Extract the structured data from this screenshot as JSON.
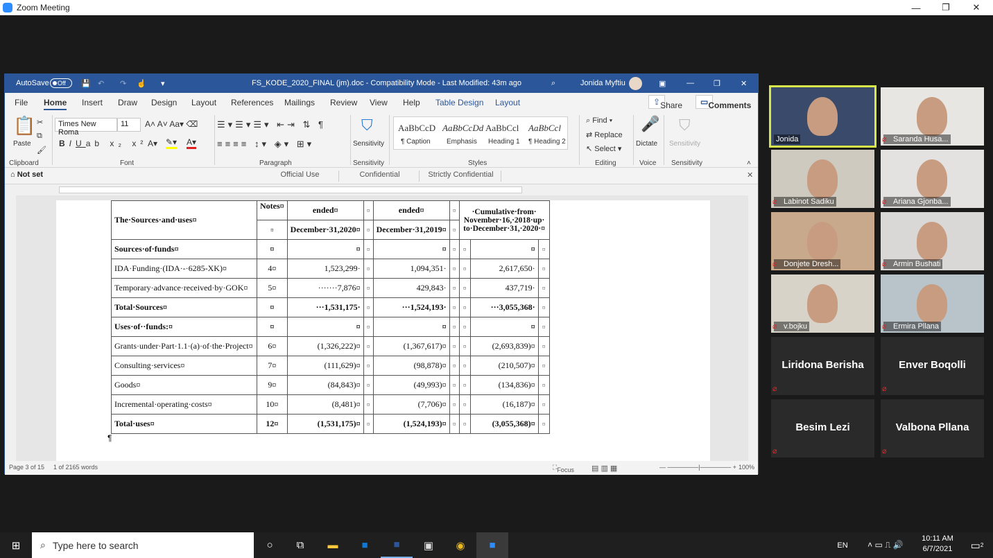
{
  "zoom": {
    "title": "Zoom Meeting"
  },
  "word": {
    "autosave_label": "AutoSave",
    "autosave_state": "Off",
    "doc_title": "FS_KODE_2020_FINAL (jm).doc  -  Compatibility Mode  -  Last Modified: 43m ago",
    "user": "Jonida Myftiu",
    "tabs": [
      "File",
      "Home",
      "Insert",
      "Draw",
      "Design",
      "Layout",
      "References",
      "Mailings",
      "Review",
      "View",
      "Help",
      "Table Design",
      "Layout"
    ],
    "share": "Share",
    "comments": "Comments",
    "ribbon": {
      "paste": "Paste",
      "font_name": "Times New Roma",
      "font_size": "11",
      "groups": [
        "Clipboard",
        "Font",
        "Paragraph",
        "Sensitivity",
        "Styles",
        "Editing",
        "Voice",
        "Sensitivity"
      ],
      "styles": [
        {
          "sample": "AaBbCcD",
          "name": "¶ Caption"
        },
        {
          "sample": "AaBbCcDd",
          "name": "Emphasis"
        },
        {
          "sample": "AaBbCcl",
          "name": "Heading 1"
        },
        {
          "sample": "AaBbCcl",
          "name": "¶ Heading 2"
        }
      ],
      "sensitivity": "Sensitivity",
      "find": "Find",
      "replace": "Replace",
      "select": "Select",
      "dictate": "Dictate",
      "sensitivity2": "Sensitivity"
    },
    "sensbar": {
      "not_set": "Not set",
      "labels": [
        "Official Use",
        "Confidential",
        "Strictly Confidential"
      ]
    },
    "table": {
      "header_title": "The·Sources·and·uses¤",
      "notes": "Notes¤",
      "ended1": "ended¤",
      "ended2": "ended¤",
      "date1": "December·31,2020¤",
      "date2": "December·31,2019¤",
      "cumulative": "·Cumulative·from· November·16,·2018·up· to·December·31,·2020·¤",
      "rows": [
        {
          "label": "Sources·of·funds¤",
          "note": "¤",
          "a": "¤",
          "b": "¤",
          "c": "¤",
          "bold": true
        },
        {
          "label": "IDA·Funding·(IDA·-·6285-XK)¤",
          "note": "4¤",
          "a": "1,523,299·",
          "b": "1,094,351·",
          "c": "2,617,650·",
          "bold": false
        },
        {
          "label": "Temporary·advance·received·by·GOK¤",
          "note": "5¤",
          "a": "·······7,876¤",
          "b": "429,843·",
          "c": "437,719·",
          "bold": false
        },
        {
          "label": "Total·Sources¤",
          "note": "¤",
          "a": "···1,531,175·",
          "b": "···1,524,193·",
          "c": "···3,055,368·",
          "bold": true
        },
        {
          "label": "Uses·of··funds:¤",
          "note": "¤",
          "a": "¤",
          "b": "¤",
          "c": "¤",
          "bold": true
        },
        {
          "label": "Grants·under·Part·1.1·(a)·of·the·Project¤",
          "note": "6¤",
          "a": "(1,326,222)¤",
          "b": "(1,367,617)¤",
          "c": "(2,693,839)¤",
          "bold": false
        },
        {
          "label": "Consulting·services¤",
          "note": "7¤",
          "a": "(111,629)¤",
          "b": "(98,878)¤",
          "c": "(210,507)¤",
          "bold": false
        },
        {
          "label": "Goods¤",
          "note": "9¤",
          "a": "(84,843)¤",
          "b": "(49,993)¤",
          "c": "(134,836)¤",
          "bold": false
        },
        {
          "label": "Incremental·operating·costs¤",
          "note": "10¤",
          "a": "(8,481)¤",
          "b": "(7,706)¤",
          "c": "(16,187)¤",
          "bold": false
        },
        {
          "label": "Total·uses¤",
          "note": "12¤",
          "a": "(1,531,175)¤",
          "b": "(1,524,193)¤",
          "c": "(3,055,368)¤",
          "bold": true
        }
      ],
      "para": "¶"
    },
    "status": {
      "page": "Page 3 of 15",
      "words": "1 of 2165 words",
      "focus": "Focus",
      "zoom": "100%"
    }
  },
  "participants": [
    {
      "name": "Jonida",
      "muted": false,
      "video": true,
      "active": true,
      "bg": "#3a4a6a"
    },
    {
      "name": "Saranda Husa...",
      "muted": true,
      "video": true,
      "bg": "#e8e6e2"
    },
    {
      "name": "Labinot Sadiku",
      "muted": true,
      "video": true,
      "bg": "#cfcac0"
    },
    {
      "name": "Ariana Gjonba...",
      "muted": true,
      "video": true,
      "bg": "#e4e2e0"
    },
    {
      "name": "Donjete Dresh...",
      "muted": true,
      "video": true,
      "bg": "#c9a98c"
    },
    {
      "name": "Armin Bushati",
      "muted": true,
      "video": true,
      "bg": "#d9d8d6"
    },
    {
      "name": "v.bojku",
      "muted": true,
      "video": true,
      "bg": "#d8d3c8"
    },
    {
      "name": "Ermira  Pllana",
      "muted": true,
      "video": true,
      "bg": "#b9c4ca"
    },
    {
      "name": "Liridona Berisha",
      "muted": true,
      "video": false
    },
    {
      "name": "Enver Boqolli",
      "muted": true,
      "video": false
    },
    {
      "name": "Besim Lezi",
      "muted": true,
      "video": false
    },
    {
      "name": "Valbona Pllana",
      "muted": true,
      "video": false
    }
  ],
  "taskbar": {
    "search_placeholder": "Type here to search",
    "lang": "EN",
    "time": "10:11 AM",
    "date": "6/7/2021",
    "notif": "2"
  }
}
